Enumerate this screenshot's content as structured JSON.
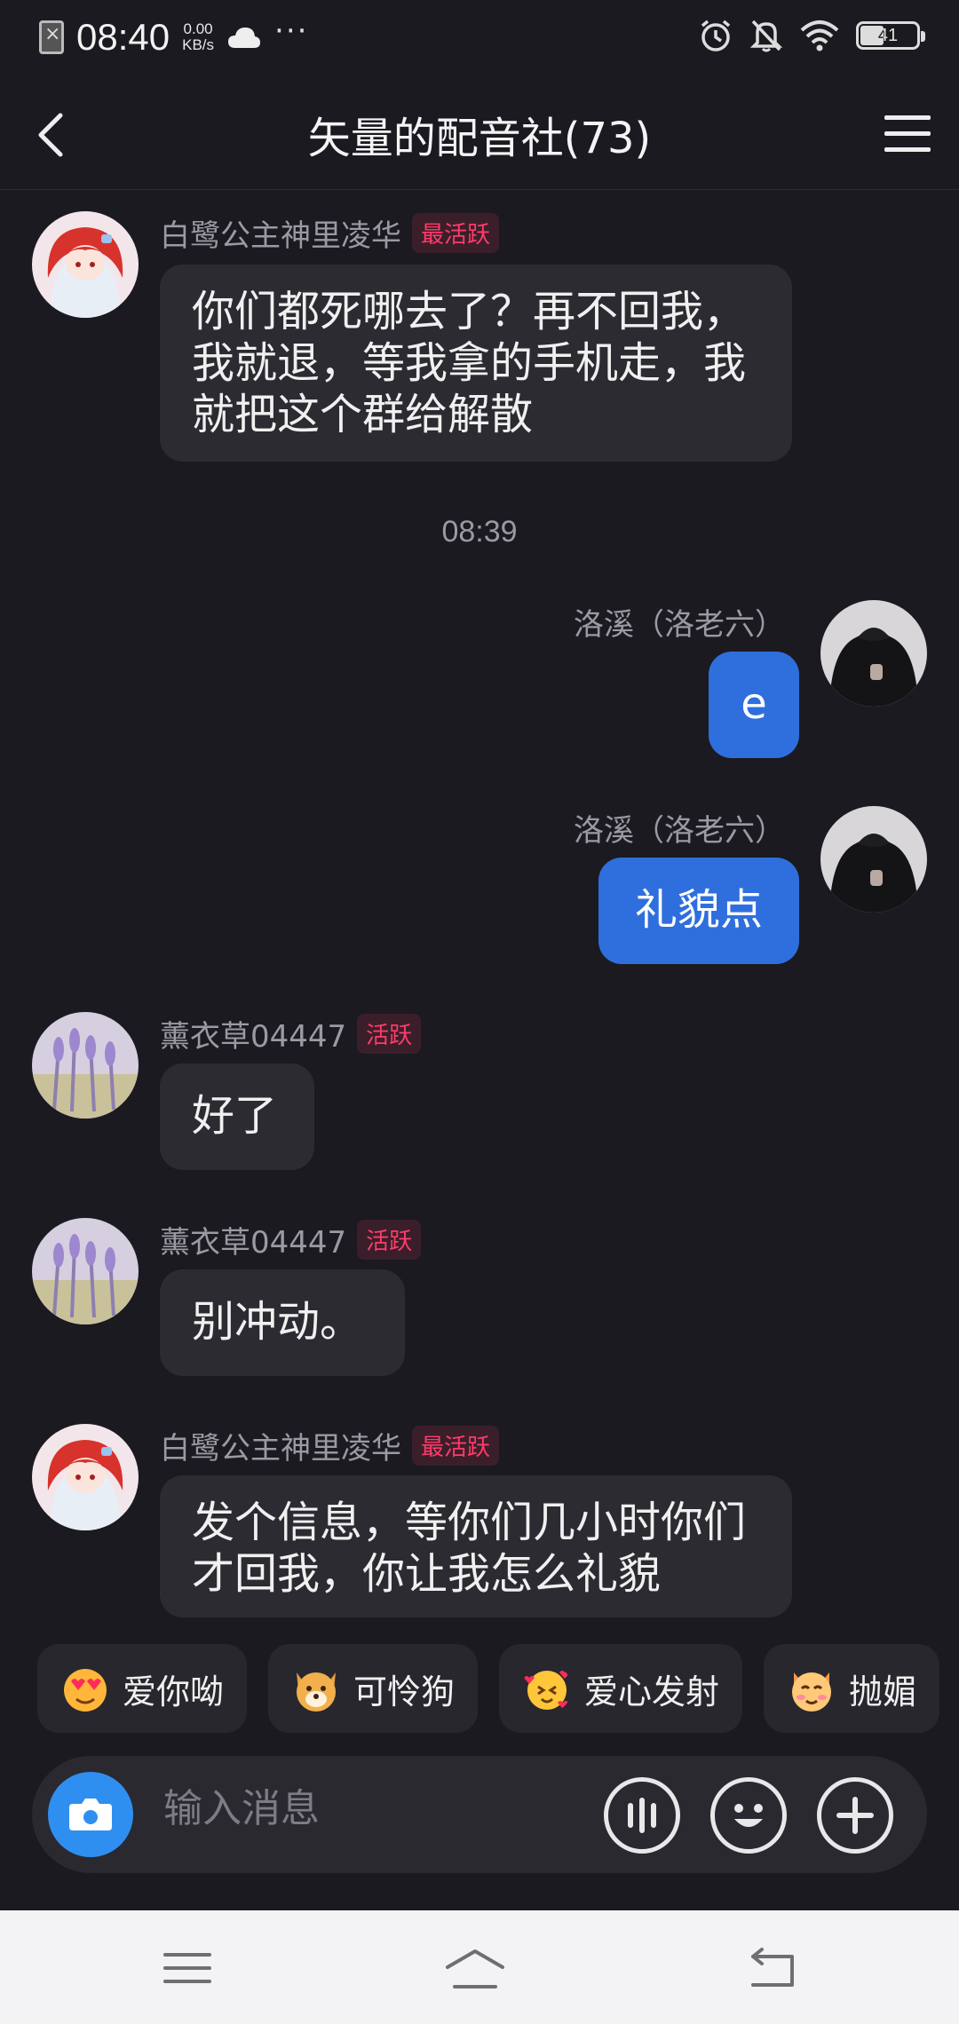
{
  "status_bar": {
    "time": "08:40",
    "speed_value": "0.00",
    "speed_unit": "KB/s",
    "more": "···",
    "battery": "41"
  },
  "header": {
    "title": "矢量的配音社(73)"
  },
  "messages": [
    {
      "sender": "白鹭公主神里凌华",
      "badge": "最活跃",
      "text": "你们都死哪去了？再不回我，我就退，等我拿的手机走，我就把这个群给解散",
      "mine": false
    },
    {
      "sender": "洛溪（洛老六）",
      "text": "e",
      "mine": true
    },
    {
      "sender": "洛溪（洛老六）",
      "text": "礼貌点",
      "mine": true
    },
    {
      "sender": "薰衣草04447",
      "badge": "活跃",
      "text": "好了",
      "mine": false
    },
    {
      "sender": "薰衣草04447",
      "badge": "活跃",
      "text": "别冲动。",
      "mine": false
    },
    {
      "sender": "白鹭公主神里凌华",
      "badge": "最活跃",
      "text": "发个信息，等你们几小时你们才回我，你让我怎么礼貌",
      "mine": false
    }
  ],
  "timestamp": "08:39",
  "quick_replies": [
    {
      "label": "爱你呦",
      "icon": "heart-eyes-emoji-icon"
    },
    {
      "label": "可怜狗",
      "icon": "puppy-emoji-icon"
    },
    {
      "label": "爱心发射",
      "icon": "heart-burst-emoji-icon"
    },
    {
      "label": "抛媚",
      "icon": "wink-emoji-icon"
    }
  ],
  "input": {
    "placeholder": "输入消息"
  },
  "colors": {
    "background": "#1b1a20",
    "bubble_other": "#2c2b31",
    "bubble_mine": "#2f6fdd",
    "badge_text": "#ff3b6b",
    "camera": "#2f8ff0"
  }
}
